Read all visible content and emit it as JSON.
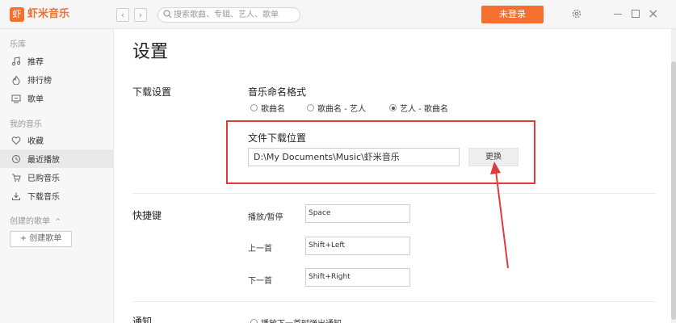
{
  "app": {
    "logo_glyph": "虾",
    "name": "虾米音乐",
    "accent": "#f56f2f"
  },
  "header": {
    "search_placeholder": "搜索歌曲、专辑、艺人、歌单",
    "login_label": "未登录"
  },
  "sidebar": {
    "section_library": "乐库",
    "library_items": [
      {
        "label": "推荐",
        "icon": "music-note-icon"
      },
      {
        "label": "排行榜",
        "icon": "flame-icon"
      },
      {
        "label": "歌单",
        "icon": "playlist-icon"
      }
    ],
    "section_my": "我的音乐",
    "my_items": [
      {
        "label": "收藏",
        "icon": "heart-icon"
      },
      {
        "label": "最近播放",
        "icon": "clock-icon",
        "active": true
      },
      {
        "label": "已购音乐",
        "icon": "cart-icon"
      },
      {
        "label": "下载音乐",
        "icon": "download-icon"
      }
    ],
    "section_created": "创建的歌单",
    "create_button": "+ 创建歌单"
  },
  "settings": {
    "page_title": "设置",
    "download": {
      "section_title": "下载设置",
      "naming_label": "音乐命名格式",
      "naming_options": [
        {
          "label": "歌曲名",
          "selected": false
        },
        {
          "label": "歌曲名 - 艺人",
          "selected": false
        },
        {
          "label": "艺人 - 歌曲名",
          "selected": true
        }
      ],
      "location_label": "文件下载位置",
      "location_value": "D:\\My Documents\\Music\\虾米音乐",
      "change_button": "更换"
    },
    "shortcuts": {
      "section_title": "快捷键",
      "items": [
        {
          "label": "播放/暂停",
          "value": "Space"
        },
        {
          "label": "上一首",
          "value": "Shift+Left"
        },
        {
          "label": "下一首",
          "value": "Shift+Right"
        }
      ]
    },
    "notify": {
      "section_title": "通知",
      "option_label": "播放下一首时弹出通知"
    }
  },
  "annotation": {
    "color": "#e03a3a"
  }
}
